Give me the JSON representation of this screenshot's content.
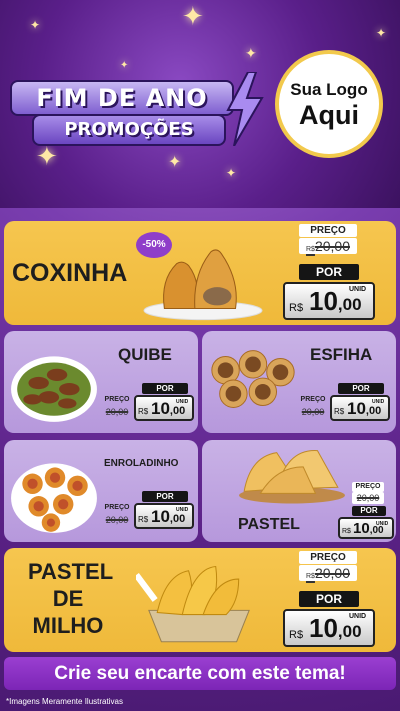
{
  "header": {
    "title_line1": "FIM DE ANO",
    "title_line2": "PROMOÇÕES",
    "logo_line1": "Sua Logo",
    "logo_line2": "Aqui"
  },
  "labels": {
    "preco": "PREÇO",
    "por": "POR",
    "currency": "R$",
    "unid": "UNID"
  },
  "products": [
    {
      "name": "COXINHA",
      "old_price": "20,00",
      "new_int": "10",
      "new_dec": ",00",
      "badge": "-50%"
    },
    {
      "name": "QUIBE",
      "old_price": "20,00",
      "new_int": "10",
      "new_dec": ",00"
    },
    {
      "name": "ESFIHA",
      "old_price": "20,00",
      "new_int": "10",
      "new_dec": ",00"
    },
    {
      "name": "ENROLADINHO",
      "old_price": "20,00",
      "new_int": "10",
      "new_dec": ",00"
    },
    {
      "name": "PASTEL",
      "old_price": "20,00",
      "new_int": "10",
      "new_dec": ",00"
    },
    {
      "name_lines": [
        "PASTEL",
        "DE",
        "MILHO"
      ],
      "old_price": "20,00",
      "new_int": "10",
      "new_dec": ",00"
    }
  ],
  "cta": "Crie seu encarte com este tema!",
  "footer": "*Imagens Meramente Ilustrativas"
}
